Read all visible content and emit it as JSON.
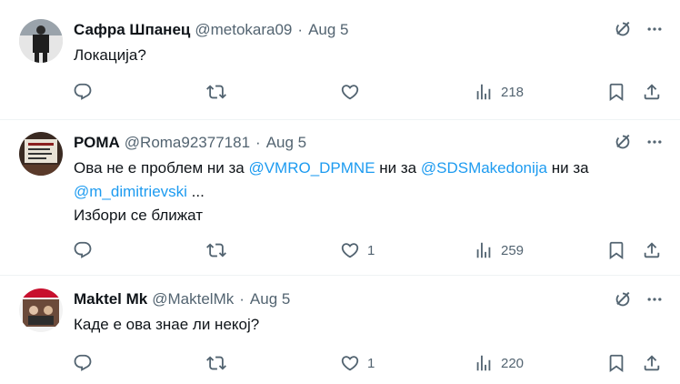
{
  "tweets": [
    {
      "name": "Сафра Шпанец",
      "handle": "@metokara09",
      "separator": "·",
      "date": "Aug 5",
      "text": "Локација?",
      "likes": "",
      "views": "218"
    },
    {
      "name": "РОМА",
      "handle": "@Roma92377181",
      "separator": "·",
      "date": "Aug 5",
      "text_parts": {
        "p1": "Ова не е проблем ни за ",
        "m1": "@VMRO_DPMNE",
        "p2": " ни за ",
        "m2": "@SDSMakedonija",
        "p3": " ни за",
        "m3": "@m_dimitrievski",
        "p4": " ...",
        "line3": "Избори се ближат"
      },
      "likes": "1",
      "views": "259"
    },
    {
      "name": "Maktel Mk",
      "handle": "@MaktelMk",
      "separator": "·",
      "date": "Aug 5",
      "text": "Каде е ова знае ли некој?",
      "likes": "1",
      "views": "220"
    }
  ],
  "colors": {
    "text": "#0f1419",
    "secondary": "#536471",
    "mention": "#1d9bf0",
    "divider": "#eff3f4"
  },
  "icons": [
    "grok-icon",
    "more-icon",
    "reply-icon",
    "retweet-icon",
    "like-icon",
    "views-icon",
    "bookmark-icon",
    "share-icon"
  ]
}
